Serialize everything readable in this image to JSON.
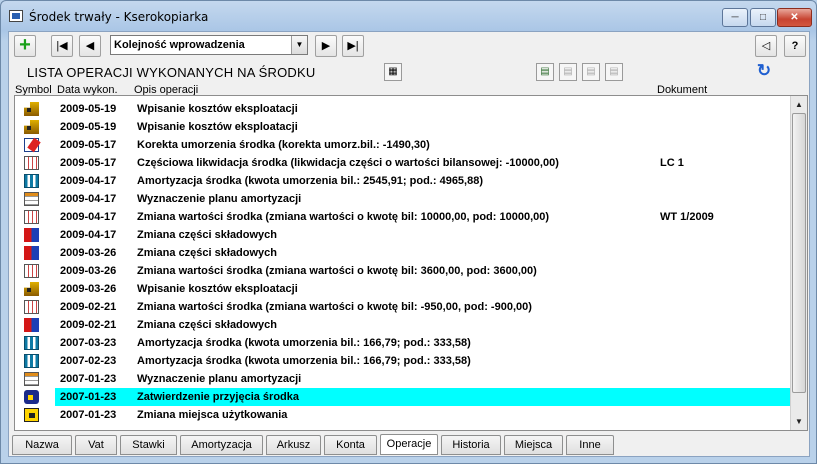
{
  "window": {
    "title": "Środek trwały - Ksero­kopiarka",
    "min": "─",
    "max": "□",
    "close": "✕"
  },
  "toolbar": {
    "add": "+",
    "first": "|◀",
    "prev": "◀",
    "next": "▶",
    "last": "▶|",
    "prev_record": "◁",
    "help": "?",
    "order_value": "Kolejność wprowadzenia",
    "order_arrow": "▼"
  },
  "section": {
    "heading": "LISTA OPERACJI WYKONANYCH NA ŚRODKU",
    "refresh": "↻"
  },
  "columns": {
    "symbol": "Symbol",
    "date": "Data wykon.",
    "desc": "Opis operacji",
    "doc": "Dokument"
  },
  "rows": [
    {
      "icon": "cost",
      "date": "2009-05-19",
      "desc": "Wpisanie kosztów eksploatacji",
      "doc": ""
    },
    {
      "icon": "cost",
      "date": "2009-05-19",
      "desc": "Wpisanie kosztów eksploatacji",
      "doc": ""
    },
    {
      "icon": "corr",
      "date": "2009-05-17",
      "desc": "Korekta umorzenia środka (korekta umorz.bil.: -1490,30)",
      "doc": ""
    },
    {
      "icon": "value",
      "date": "2009-05-17",
      "desc": "Częściowa likwidacja środka (likwidacja części o wartości bilansowej: -10000,00)",
      "doc": "LC 1"
    },
    {
      "icon": "amort",
      "date": "2009-04-17",
      "desc": "Amortyzacja środka (kwota umorzenia bil.: 2545,91; pod.: 4965,88)",
      "doc": ""
    },
    {
      "icon": "plan",
      "date": "2009-04-17",
      "desc": "Wyznaczenie planu amortyzacji",
      "doc": ""
    },
    {
      "icon": "value",
      "date": "2009-04-17",
      "desc": "Zmiana wartości środka (zmiana wartości o kwotę bil: 10000,00, pod: 10000,00)",
      "doc": "WT 1/2009"
    },
    {
      "icon": "parts",
      "date": "2009-04-17",
      "desc": "Zmiana części składowych",
      "doc": ""
    },
    {
      "icon": "parts",
      "date": "2009-03-26",
      "desc": "Zmiana części składowych",
      "doc": ""
    },
    {
      "icon": "value",
      "date": "2009-03-26",
      "desc": "Zmiana wartości środka (zmiana wartości o kwotę bil: 3600,00, pod: 3600,00)",
      "doc": ""
    },
    {
      "icon": "cost",
      "date": "2009-03-26",
      "desc": "Wpisanie kosztów eksploatacji",
      "doc": ""
    },
    {
      "icon": "value",
      "date": "2009-02-21",
      "desc": "Zmiana wartości środka (zmiana wartości o kwotę bil: -950,00, pod: -900,00)",
      "doc": ""
    },
    {
      "icon": "parts",
      "date": "2009-02-21",
      "desc": "Zmiana części składowych",
      "doc": ""
    },
    {
      "icon": "amort",
      "date": "2007-03-23",
      "desc": "Amortyzacja środka (kwota umorzenia bil.: 166,79; pod.: 333,58)",
      "doc": ""
    },
    {
      "icon": "amort",
      "date": "2007-02-23",
      "desc": "Amortyzacja środka (kwota umorzenia bil.: 166,79; pod.: 333,58)",
      "doc": ""
    },
    {
      "icon": "plan",
      "date": "2007-01-23",
      "desc": "Wyznaczenie planu amortyzacji",
      "doc": ""
    },
    {
      "icon": "accept",
      "date": "2007-01-23",
      "desc": "Zatwierdzenie przyjęcia środka",
      "doc": "",
      "selected": true
    },
    {
      "icon": "location",
      "date": "2007-01-23",
      "desc": "Zmiana miejsca użytkowania",
      "doc": ""
    }
  ],
  "scrollbar": {
    "up": "▲",
    "down": "▼"
  },
  "tabs": [
    {
      "label": "Nazwa"
    },
    {
      "label": "Vat"
    },
    {
      "label": "Stawki"
    },
    {
      "label": "Amortyzacja"
    },
    {
      "label": "Arkusz"
    },
    {
      "label": "Konta"
    },
    {
      "label": "Operacje",
      "active": true
    },
    {
      "label": "Historia"
    },
    {
      "label": "Miejsca"
    },
    {
      "label": "Inne"
    }
  ]
}
